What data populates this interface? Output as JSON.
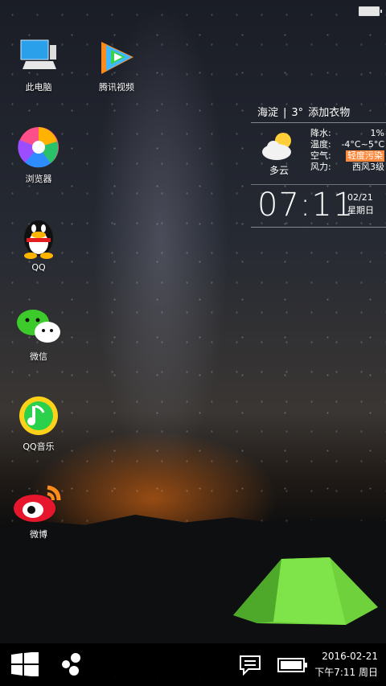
{
  "desktop": {
    "icons": [
      {
        "label": "此电脑",
        "icon": "computer-icon"
      },
      {
        "label": "腾讯视频",
        "icon": "tencent-video-icon"
      },
      {
        "label": "浏览器",
        "icon": "browser-icon"
      },
      {
        "label": "QQ",
        "icon": "qq-icon"
      },
      {
        "label": "微信",
        "icon": "wechat-icon"
      },
      {
        "label": "QQ音乐",
        "icon": "qq-music-icon"
      },
      {
        "label": "微博",
        "icon": "weibo-icon"
      }
    ]
  },
  "weather": {
    "location": "海淀",
    "temp": "3°",
    "advice": "添加衣物",
    "separator": "|",
    "condition": "多云",
    "rows": [
      {
        "k": "降水:",
        "v": "1%"
      },
      {
        "k": "温度:",
        "v": "-4°C~5°C"
      },
      {
        "k": "空气:",
        "v": "轻度污染"
      },
      {
        "k": "风力:",
        "v": "西风3级"
      }
    ],
    "time": "07:11",
    "date": "02/21",
    "weekday": "星期日",
    "colors": {
      "air_badge": "#ff8a3d"
    }
  },
  "taskbar": {
    "date": "2016-02-21",
    "time_line": "下午7:11 周日",
    "icons": [
      "windows-start-icon",
      "dots-menu-icon",
      "notification-icon",
      "battery-icon"
    ]
  }
}
